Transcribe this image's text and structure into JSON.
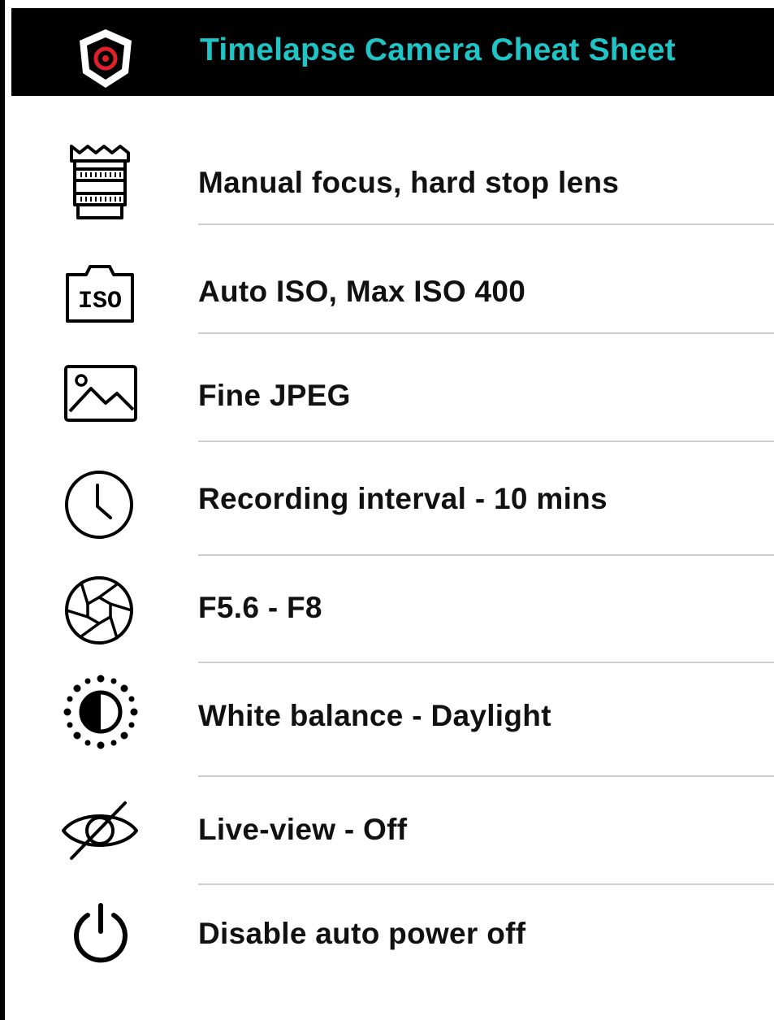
{
  "header": {
    "title": "Timelapse Camera Cheat Sheet",
    "title_color": "#1fc4c6",
    "background": "#000000",
    "logo_icon": "shield-camera-icon",
    "logo_accent": "#e0202a"
  },
  "settings": [
    {
      "icon": "lens-icon",
      "label": "Manual focus, hard stop lens"
    },
    {
      "icon": "iso-camera-icon",
      "label": "Auto ISO, Max ISO 400"
    },
    {
      "icon": "image-icon",
      "label": "Fine JPEG"
    },
    {
      "icon": "clock-icon",
      "label": "Recording interval - 10 mins"
    },
    {
      "icon": "aperture-icon",
      "label": "F5.6 - F8"
    },
    {
      "icon": "brightness-icon",
      "label": "White balance - Daylight"
    },
    {
      "icon": "eye-off-icon",
      "label": "Live-view - Off"
    },
    {
      "icon": "power-icon",
      "label": "Disable auto power off"
    }
  ],
  "icon_text": {
    "iso": "ISO"
  }
}
